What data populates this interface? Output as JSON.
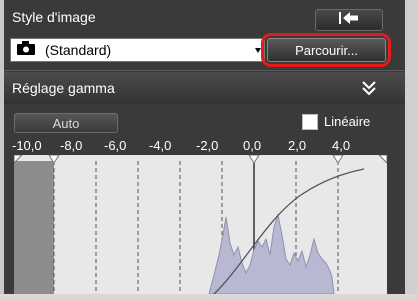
{
  "style_section": {
    "title": "Style d'image",
    "back_icon": "undo-arrow-icon",
    "select_value": "(Standard)",
    "camera_icon": "camera-icon",
    "browse_label": "Parcourir..."
  },
  "gamma_section": {
    "title": "Réglage gamma",
    "collapse_icon": "double-chevron-down-icon",
    "auto_label": "Auto",
    "linear_label": "Linéaire",
    "linear_checked": false,
    "scale_labels": [
      "-10,0",
      "-8,0",
      "-6,0",
      "-4,0",
      "-2,0",
      "0,0",
      "2,0",
      "4,0"
    ]
  },
  "colors": {
    "highlight": "#e21b1b",
    "panel_bg": "#3a3a3a",
    "histogram_fill": "#b8b8d2"
  }
}
